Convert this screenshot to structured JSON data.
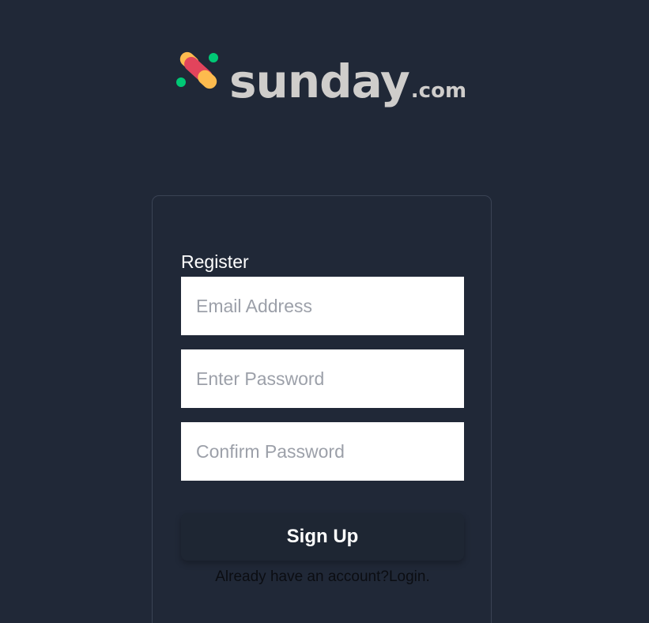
{
  "brand": {
    "name": "sunday",
    "suffix": ".com",
    "colors": {
      "green": "#00c875",
      "yellow": "#fdbb4e",
      "red": "#e2445c",
      "wordmark": "#cfcdcb"
    }
  },
  "form": {
    "title": "Register",
    "email": {
      "placeholder": "Email Address",
      "value": ""
    },
    "password": {
      "placeholder": "Enter Password",
      "value": ""
    },
    "confirm_password": {
      "placeholder": "Confirm Password",
      "value": ""
    },
    "submit_label": "Sign Up",
    "login_prompt": "Already have an account?",
    "login_link": "Login",
    "login_trailing": "."
  },
  "colors": {
    "background": "#202837",
    "card_border": "#3a4354",
    "button_bg": "#1e2633"
  }
}
